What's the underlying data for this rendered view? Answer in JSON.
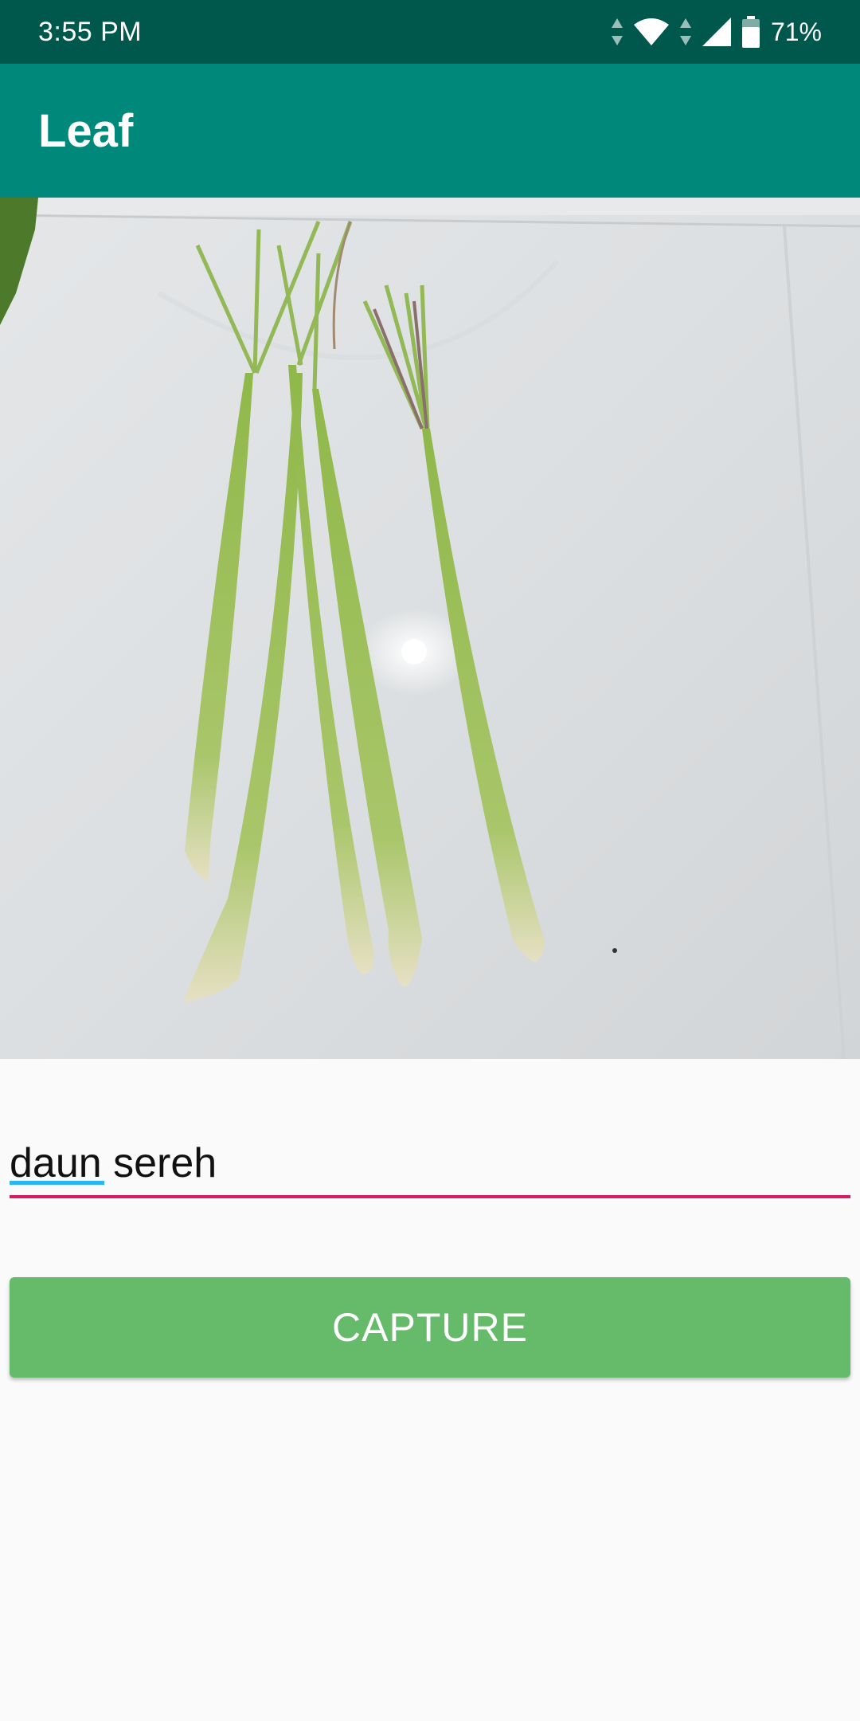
{
  "status_bar": {
    "time": "3:55 PM",
    "battery_level": "71%",
    "icons": [
      "data-arrows-icon",
      "wifi-icon",
      "data-arrows-icon",
      "cell-signal-icon",
      "battery-icon"
    ]
  },
  "app_bar": {
    "title": "Leaf"
  },
  "preview": {
    "icon": "camera-preview-image"
  },
  "label_input": {
    "value": "daun sereh"
  },
  "capture_button": {
    "label": "CAPTURE"
  },
  "colors": {
    "status_bar": "#00584c",
    "app_bar": "#00897b",
    "input_underline": "#d81b60",
    "button": "#66bb6a",
    "background": "#fafafa"
  }
}
